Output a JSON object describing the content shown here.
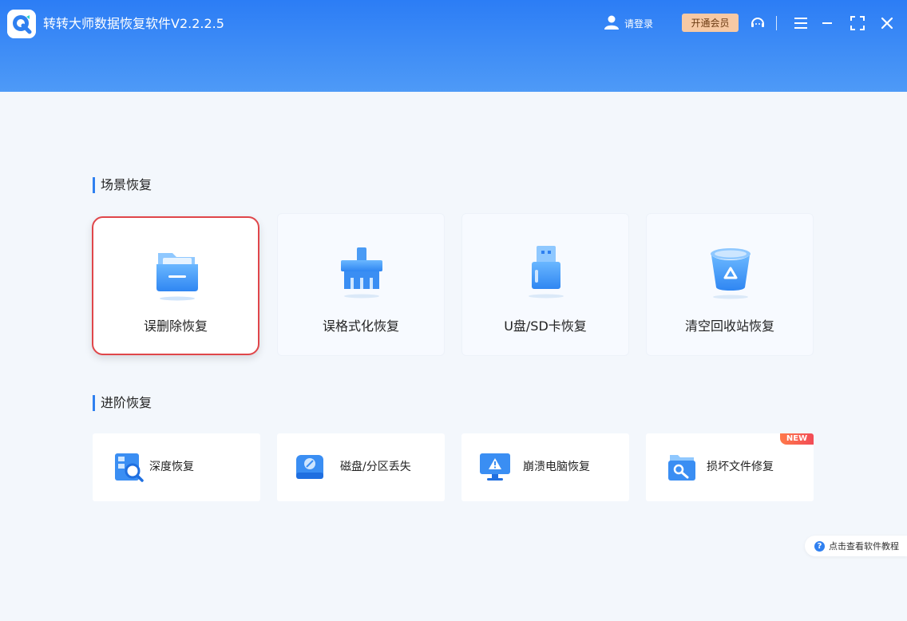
{
  "app": {
    "title": "转转大师数据恢复软件V2.2.2.5"
  },
  "header": {
    "login_label": "请登录",
    "vip_label": "开通会员",
    "icons": [
      "user-icon",
      "support-icon",
      "menu-icon",
      "minimize-icon",
      "maximize-icon",
      "close-icon"
    ]
  },
  "scene_section": {
    "title": "场景恢复",
    "cards": [
      {
        "label": "误删除恢复",
        "icon": "folder-icon",
        "selected": true
      },
      {
        "label": "误格式化恢复",
        "icon": "broom-icon",
        "selected": false
      },
      {
        "label": "U盘/SD卡恢复",
        "icon": "usb-drive-icon",
        "selected": false
      },
      {
        "label": "清空回收站恢复",
        "icon": "recycle-bin-icon",
        "selected": false
      }
    ]
  },
  "advanced_section": {
    "title": "进阶恢复",
    "items": [
      {
        "label": "深度恢复",
        "icon": "deep-scan-icon"
      },
      {
        "label": "磁盘/分区丢失",
        "icon": "disk-icon"
      },
      {
        "label": "崩溃电脑恢复",
        "icon": "crashed-monitor-icon"
      },
      {
        "label": "损坏文件修复",
        "icon": "file-repair-icon",
        "badge": "NEW"
      }
    ]
  },
  "tutorial": {
    "label": "点击查看软件教程",
    "icon_text": "?"
  },
  "colors": {
    "accent": "#2f80f0",
    "header_top": "#2c7df5",
    "selection": "#e0464a",
    "vip_bg": "#f7c9a4"
  }
}
